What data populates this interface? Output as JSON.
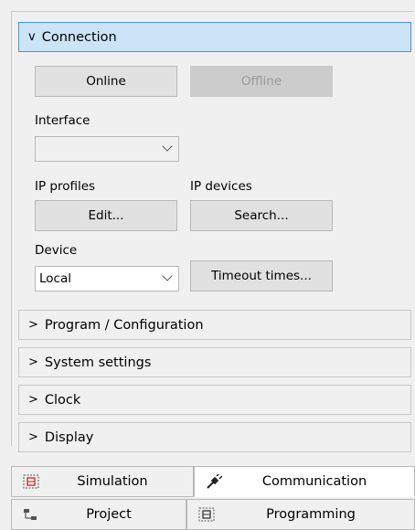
{
  "connection": {
    "header_label": "Connection",
    "header_chevron": "v",
    "online_label": "Online",
    "offline_label": "Offline",
    "interface_label": "Interface",
    "interface_value": "",
    "ip_profiles_label": "IP profiles",
    "ip_devices_label": "IP devices",
    "edit_label": "Edit...",
    "search_label": "Search...",
    "device_label": "Device",
    "device_value": "Local",
    "timeout_label": "Timeout times..."
  },
  "sections": [
    {
      "chevron": ">",
      "label": "Program / Configuration"
    },
    {
      "chevron": ">",
      "label": "System settings"
    },
    {
      "chevron": ">",
      "label": "Clock"
    },
    {
      "chevron": ">",
      "label": "Display"
    }
  ],
  "tabs_row1": [
    {
      "label": "Simulation",
      "icon": "simulation-icon",
      "active": false
    },
    {
      "label": "Communication",
      "icon": "plug-icon",
      "active": true
    }
  ],
  "tabs_row2": [
    {
      "label": "Project",
      "icon": "project-tree-icon",
      "active": false
    },
    {
      "label": "Programming",
      "icon": "programming-icon",
      "active": false
    }
  ],
  "colors": {
    "header_open_bg": "#cce4f7",
    "header_open_border": "#4a90d9",
    "icon_red": "#d01f1f"
  }
}
